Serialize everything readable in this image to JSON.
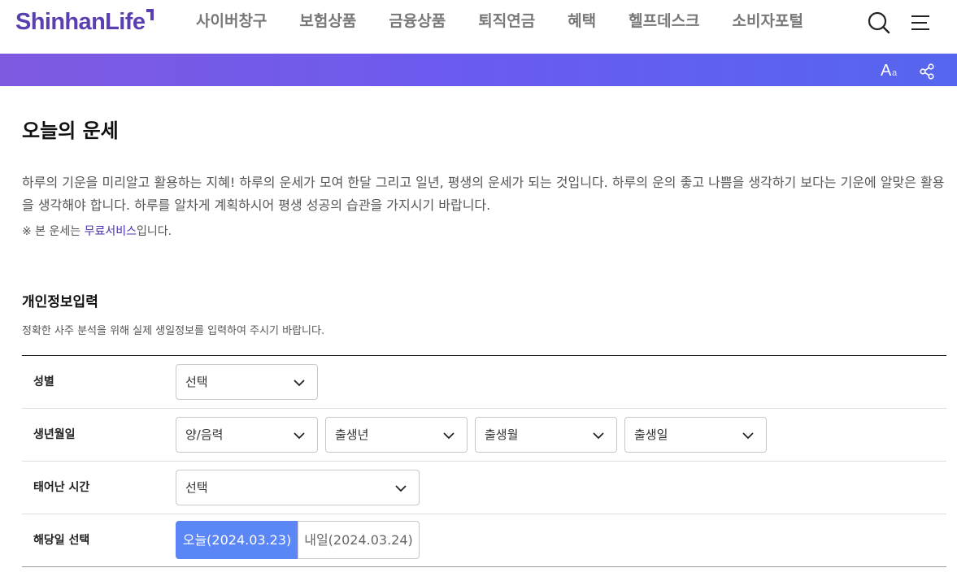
{
  "header": {
    "logo": "ShinhanLife",
    "nav": [
      "사이버창구",
      "보험상품",
      "금융상품",
      "퇴직연금",
      "혜택",
      "헬프데스크",
      "소비자포털"
    ],
    "icons": {
      "search": "search-icon",
      "menu": "hamburger-menu-icon"
    }
  },
  "toolbar": {
    "font_size_big": "A",
    "font_size_small": "a",
    "icons": {
      "font": "font-size-icon",
      "share": "share-icon"
    }
  },
  "main": {
    "title": "오늘의 운세",
    "intro": "하루의 기운을 미리알고 활용하는 지혜! 하루의 운세가 모여 한달 그리고 일년, 평생의 운세가 되는 것입니다. 하루의 운의 좋고 나쁨을 생각하기 보다는 기운에 알맞은 활용을 생각해야 합니다. 하루를 알차게 계획하시어 평생 성공의 습관을 가지시기 바랍니다.",
    "note_prefix": "※ 본 운세는 ",
    "note_link": "무료서비스",
    "note_suffix": "입니다."
  },
  "form": {
    "title": "개인정보입력",
    "description": "정확한 사주 분석을 위해 실제 생일정보를 입력하여 주시기 바랍니다.",
    "gender": {
      "label": "성별",
      "value": "선택"
    },
    "birth": {
      "label": "생년월일",
      "calendar": "양/음력",
      "year": "출생년",
      "month": "출생월",
      "day": "출생일"
    },
    "birth_time": {
      "label": "태어난 시간",
      "value": "선택"
    },
    "date_select": {
      "label": "해당일 선택",
      "today": "오늘(2024.03.23)",
      "tomorrow": "내일(2024.03.24)",
      "selected": "today"
    }
  },
  "colors": {
    "brand": "#5a3fb0",
    "band_start": "#7e5ae0",
    "band_end": "#5566ee",
    "active_tab": "#5b86f5"
  }
}
